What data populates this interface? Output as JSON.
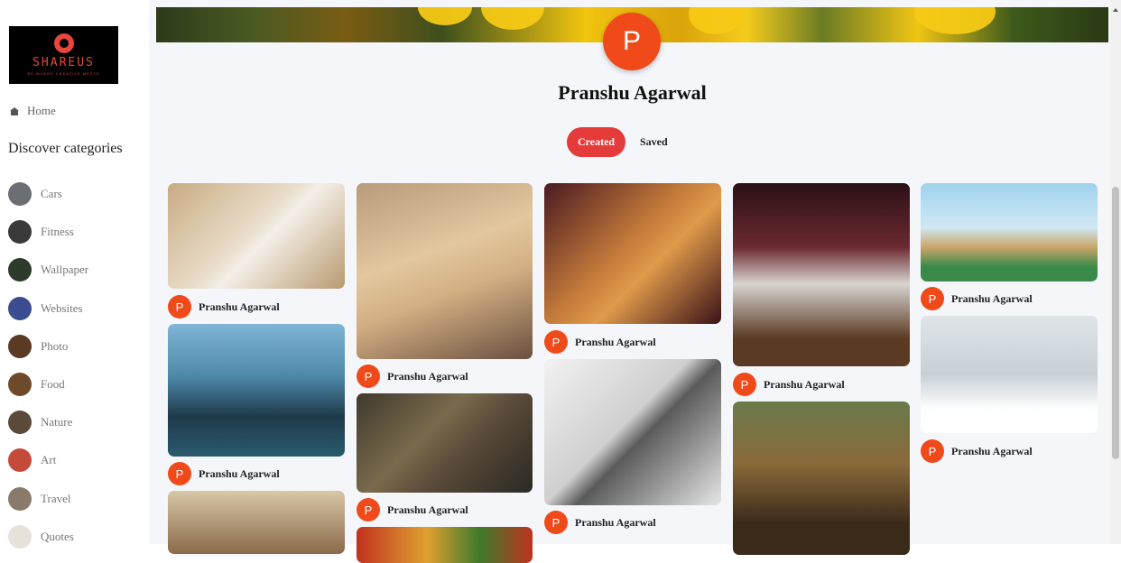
{
  "brand": {
    "name": "SHAREUS",
    "tagline": "BE WHERE CREATIVE MEETS"
  },
  "sidebar": {
    "home_label": "Home",
    "discover_heading": "Discover categories",
    "categories": [
      {
        "label": "Cars",
        "thumb": "#6b6f74"
      },
      {
        "label": "Fitness",
        "thumb": "#3a3a3a"
      },
      {
        "label": "Wallpaper",
        "thumb": "#2c3b2a"
      },
      {
        "label": "Websites",
        "thumb": "#3b4d8f"
      },
      {
        "label": "Photo",
        "thumb": "#5a3a22"
      },
      {
        "label": "Food",
        "thumb": "#6e4a2a"
      },
      {
        "label": "Nature",
        "thumb": "#5b4a3a"
      },
      {
        "label": "Art",
        "thumb": "#c44a3a"
      },
      {
        "label": "Travel",
        "thumb": "#8a7a6a"
      },
      {
        "label": "Quotes",
        "thumb": "#e6e2da"
      }
    ]
  },
  "profile": {
    "initial": "P",
    "name": "Pranshu Agarwal"
  },
  "tabs": {
    "created": "Created",
    "saved": "Saved"
  },
  "colors": {
    "accent": "#e53b3b",
    "avatar": "#f04a1b"
  },
  "pins": [
    {
      "subject": "white puppy",
      "bg": "linear-gradient(135deg,#c9ab83,#e8dcc8 45%,#f4efe7 55%,#b89a70)",
      "author": "Pranshu Agarwal"
    },
    {
      "subject": "traveler at airport window",
      "bg": "linear-gradient(180deg,#7fb5d6,#4d87a8 40%,#1e3a4a 70%,#2a5b6e)",
      "author": "Pranshu Agarwal"
    },
    {
      "subject": "gym treadmills",
      "bg": "linear-gradient(180deg,#d8c7a8,#8a6a4a)",
      "author": null
    },
    {
      "subject": "golden retriever puppy",
      "bg": "linear-gradient(160deg,#b89b7a,#e3c79e 40%,#d3b083 60%,#6b5040)",
      "author": "Pranshu Agarwal"
    },
    {
      "subject": "frida graffiti",
      "bg": "linear-gradient(135deg,#3e3a2e,#7a6a4c 40%,#5a4a3a 60%,#2a2a22)",
      "author": "Pranshu Agarwal"
    },
    {
      "subject": "vegetables",
      "bg": "linear-gradient(90deg,#c0321e,#e0a030 40%,#3e7a2a 70%,#c0321e)",
      "author": null
    },
    {
      "subject": "orange kitten",
      "bg": "linear-gradient(135deg,#4a1a22,#c47a3a 45%,#e09a4a 60%,#3a1218)",
      "author": "Pranshu Agarwal"
    },
    {
      "subject": "pencil eye drawing",
      "bg": "linear-gradient(135deg,#f2f2f2,#cfcfcf 45%,#5a5a5a 55%,#e6e6e6)",
      "author": "Pranshu Agarwal"
    },
    {
      "subject": "white kitten",
      "bg": "linear-gradient(180deg,#2a1016,#6b2a30 35%,#d8d4d0 55%,#5a3a22 85%)",
      "author": "Pranshu Agarwal"
    },
    {
      "subject": "mona lisa",
      "bg": "linear-gradient(180deg,#6a7a4a,#8a6a3a 40%,#3a2a1a 80%)",
      "author": null
    },
    {
      "subject": "world landmarks",
      "bg": "linear-gradient(180deg,#9fd2ee,#cfe8f4 45%,#caa66a 65%,#3a8a4a 85%)",
      "author": "Pranshu Agarwal"
    },
    {
      "subject": "man lifting barbell",
      "bg": "linear-gradient(180deg,#dfe4e8,#c8d0d6 50%,#ffffff 80%)",
      "author": "Pranshu Agarwal"
    }
  ]
}
